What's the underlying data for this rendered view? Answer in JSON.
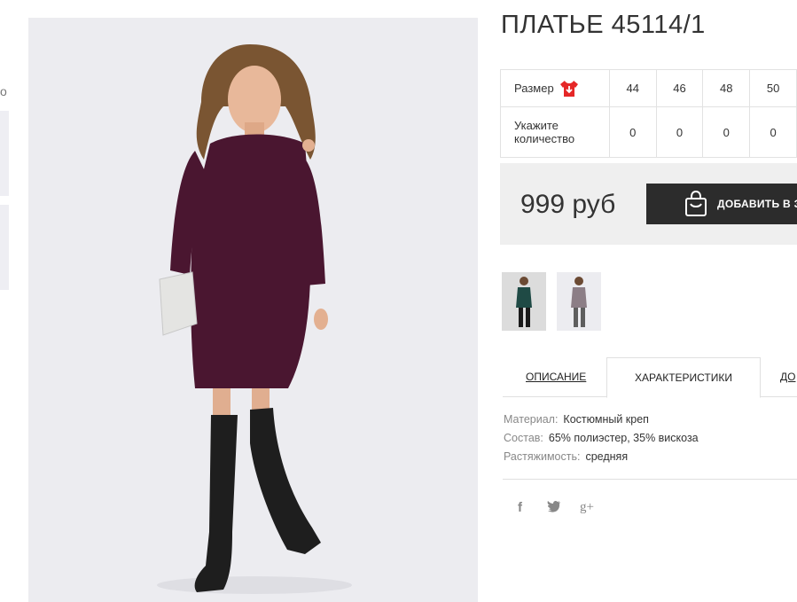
{
  "product": {
    "title": "ПЛАТЬЕ 45114/1",
    "main_image_icon": "product-photo-dress",
    "sizes_label": "Размер",
    "size_icon": "tshirt-down-arrow-icon",
    "sizes": [
      "44",
      "46",
      "48",
      "50"
    ],
    "quantity_label": "Укажите количество",
    "quantities": [
      "0",
      "0",
      "0",
      "0"
    ],
    "price": "999 руб",
    "buy_button_label": "ДОБАВИТЬ В З",
    "colors": {
      "accent_dark": "#2c2c2c",
      "size_icon_red": "#e52727"
    }
  },
  "thumbnails": [
    {
      "icon": "thumbnail-green-dress"
    },
    {
      "icon": "thumbnail-grey-dress"
    }
  ],
  "tabs": {
    "description": "ОПИСАНИЕ",
    "characteristics": "ХАРАКТЕРИСТИКИ",
    "delivery": "ДО",
    "active": "characteristics"
  },
  "specs": [
    {
      "key": "Материал:",
      "value": "Костюмный креп"
    },
    {
      "key": "Состав:",
      "value": "65% полиэстер, 35% вискоза"
    },
    {
      "key": "Растяжимость:",
      "value": "средняя"
    }
  ],
  "social": {
    "facebook": "f",
    "twitter": "t",
    "gplus": "g+"
  },
  "left_edge_glyph": "o"
}
